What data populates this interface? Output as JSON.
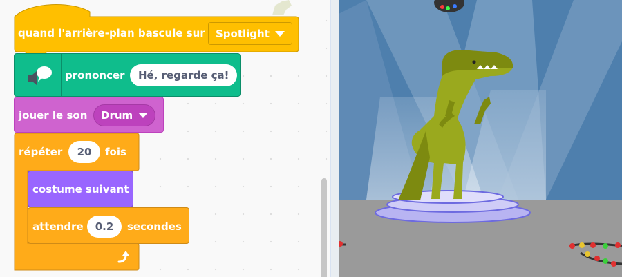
{
  "workspace": {
    "hat_block": {
      "label": "quand l'arrière-plan bascule sur",
      "backdrop_value": "Spotlight"
    },
    "say_block": {
      "label": "prononcer",
      "message": "Hé, regarde ça!"
    },
    "sound_block": {
      "label": "jouer le son",
      "sound_value": "Drum"
    },
    "repeat_block": {
      "label_before": "répéter",
      "count": "20",
      "label_after": "fois"
    },
    "costume_block": {
      "label": "costume suivant"
    },
    "wait_block": {
      "label_before": "attendre",
      "seconds": "0.2",
      "label_after": "secondes"
    }
  },
  "colors": {
    "events": "#ffbf00",
    "events_border": "#cc9900",
    "control": "#ffab19",
    "control_border": "#cf8b17",
    "sound": "#cf63cf",
    "sound_border": "#bd42bd",
    "looks": "#9966ff",
    "looks_border": "#774dcb",
    "text2speech": "#0fbd8c",
    "text2speech_border": "#0b8e69"
  },
  "icons": {
    "speech": "speech-bubble-icon",
    "loop": "loop-arrow-icon",
    "dropdown": "dropdown-caret-icon"
  }
}
